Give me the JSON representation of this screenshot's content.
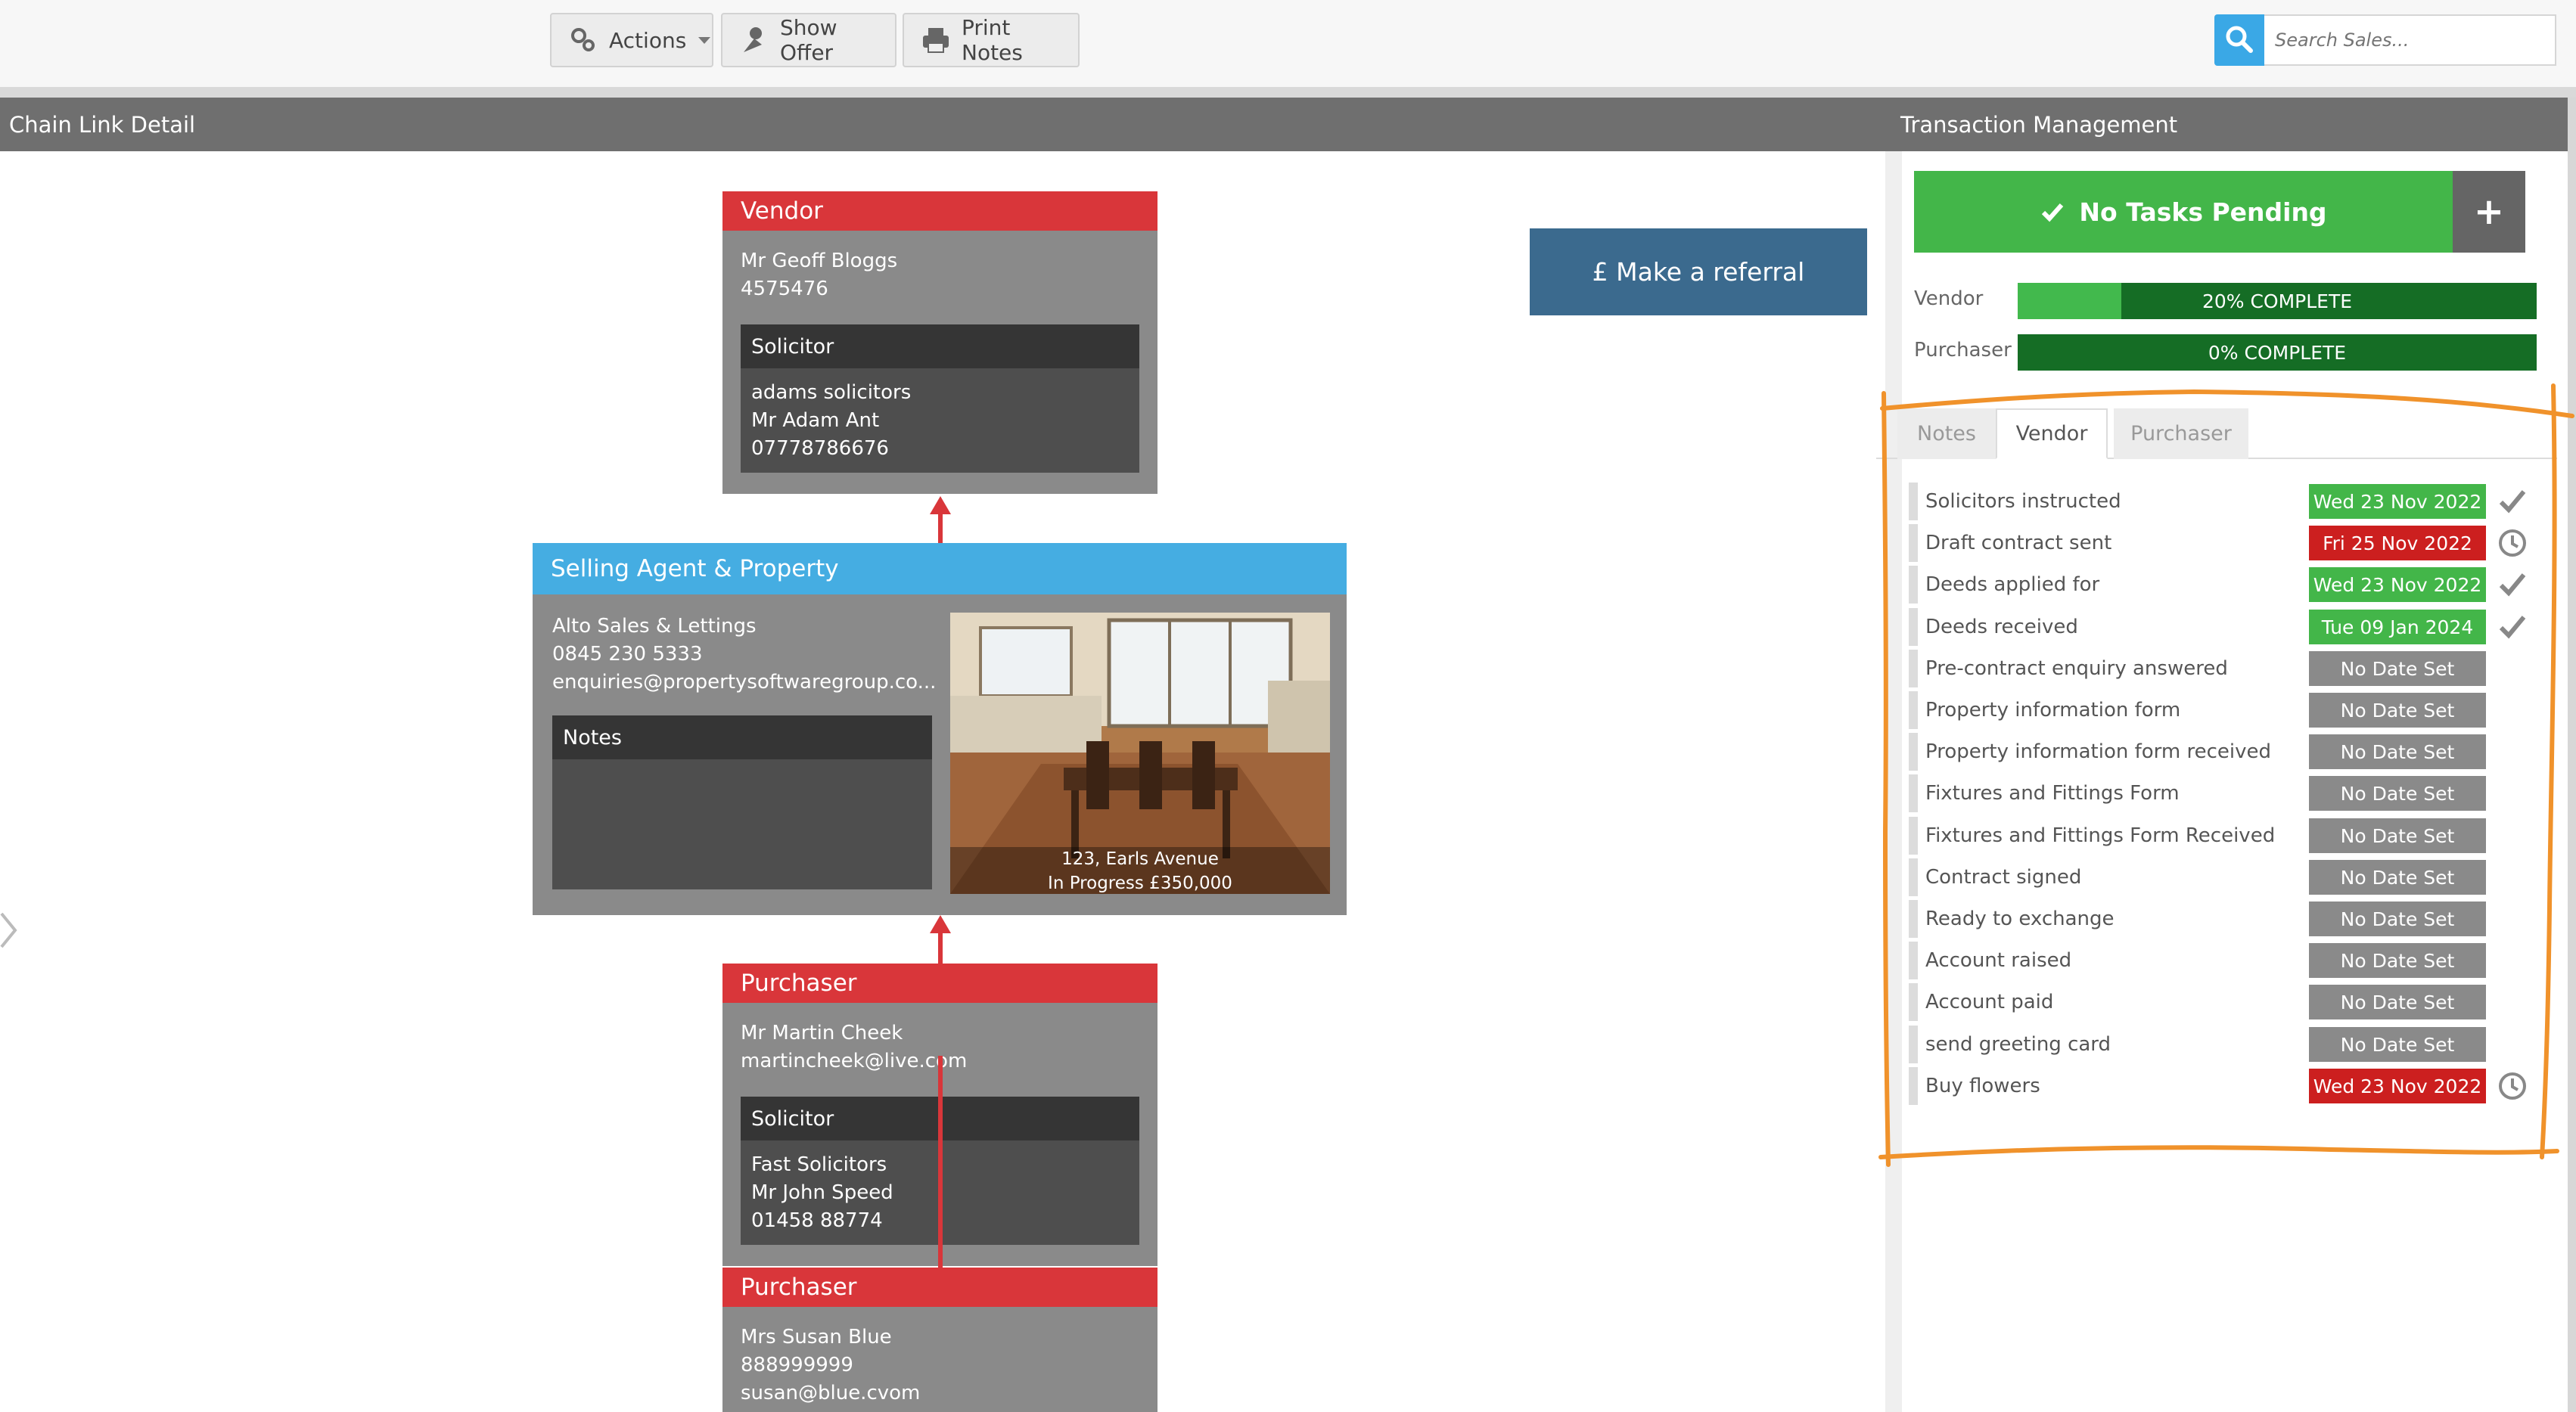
{
  "toolbar": {
    "actions_label": "Actions",
    "show_offer_label": "Show Offer",
    "print_notes_label": "Print Notes",
    "search_placeholder": "Search Sales..."
  },
  "chain": {
    "header": "Chain Link Detail",
    "vendor": {
      "title": "Vendor",
      "name": "Mr Geoff Bloggs",
      "id": "4575476",
      "solicitor_title": "Solicitor",
      "solicitor_firm": "adams solicitors",
      "solicitor_contact": "Mr Adam Ant",
      "solicitor_phone": "07778786676"
    },
    "agent": {
      "title": "Selling Agent & Property",
      "company": "Alto Sales & Lettings",
      "phone": "0845 230 5333",
      "email": "enquiries@propertysoftwaregroup.co...",
      "notes_title": "Notes",
      "property_address": "123, Earls Avenue",
      "property_status": "In Progress £350,000"
    },
    "purchaser1": {
      "title": "Purchaser",
      "name": "Mr Martin Cheek",
      "email": "martincheek@live.com",
      "solicitor_title": "Solicitor",
      "solicitor_firm": "Fast Solicitors",
      "solicitor_contact": "Mr John Speed",
      "solicitor_phone": "01458 88774"
    },
    "purchaser2": {
      "title": "Purchaser",
      "name": "Mrs Susan Blue",
      "phone": "888999999",
      "email": "susan@blue.cvom"
    }
  },
  "referral_label": "£ Make a referral",
  "transaction": {
    "header": "Transaction Management",
    "tasks_label": "No Tasks Pending",
    "add_label": "+",
    "progress": [
      {
        "label": "Vendor",
        "percent": 20,
        "text": "20% COMPLETE"
      },
      {
        "label": "Purchaser",
        "percent": 0,
        "text": "0% COMPLETE"
      }
    ],
    "tabs": [
      "Notes",
      "Vendor",
      "Purchaser"
    ],
    "active_tab": "Vendor",
    "milestones": [
      {
        "label": "Solicitors instructed",
        "date": "Wed 23 Nov 2022",
        "status": "done"
      },
      {
        "label": "Draft contract sent",
        "date": "Fri 25 Nov 2022",
        "status": "overdue"
      },
      {
        "label": "Deeds applied for",
        "date": "Wed 23 Nov 2022",
        "status": "done"
      },
      {
        "label": "Deeds received",
        "date": "Tue 09 Jan 2024",
        "status": "done"
      },
      {
        "label": "Pre-contract enquiry answered",
        "date": "No Date Set",
        "status": "none"
      },
      {
        "label": "Property information form",
        "date": "No Date Set",
        "status": "none"
      },
      {
        "label": "Property information form received",
        "date": "No Date Set",
        "status": "none"
      },
      {
        "label": "Fixtures and Fittings Form",
        "date": "No Date Set",
        "status": "none"
      },
      {
        "label": "Fixtures and Fittings Form Received",
        "date": "No Date Set",
        "status": "none"
      },
      {
        "label": "Contract signed",
        "date": "No Date Set",
        "status": "none"
      },
      {
        "label": "Ready to exchange",
        "date": "No Date Set",
        "status": "none"
      },
      {
        "label": "Account raised",
        "date": "No Date Set",
        "status": "none"
      },
      {
        "label": "Account paid",
        "date": "No Date Set",
        "status": "none"
      },
      {
        "label": "send greeting card",
        "date": "No Date Set",
        "status": "none"
      },
      {
        "label": "Buy flowers",
        "date": "Wed 23 Nov 2022",
        "status": "overdue"
      }
    ]
  },
  "colors": {
    "red": "#d9363a",
    "blue": "#45ade2",
    "green": "#43b649",
    "dark_green": "#156d25",
    "grey_pill": "#8a8a8a",
    "annotation": "#f0922b"
  }
}
